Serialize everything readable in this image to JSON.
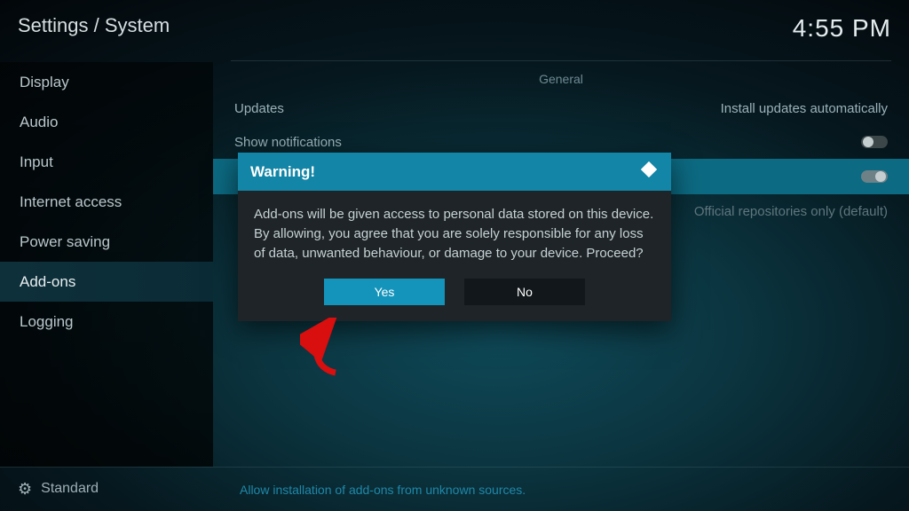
{
  "header": {
    "breadcrumb": "Settings / System",
    "clock": "4:55 PM"
  },
  "sidebar": {
    "items": [
      {
        "label": "Display"
      },
      {
        "label": "Audio"
      },
      {
        "label": "Input"
      },
      {
        "label": "Internet access"
      },
      {
        "label": "Power saving"
      },
      {
        "label": "Add-ons"
      },
      {
        "label": "Logging"
      }
    ],
    "selectedIndex": 5,
    "level_label": "Standard"
  },
  "main": {
    "section_title": "General",
    "rows": {
      "updates": {
        "label": "Updates",
        "value": "Install updates automatically"
      },
      "show_notifications": {
        "label": "Show notifications",
        "toggle": "off"
      },
      "unknown_sources": {
        "label": "",
        "toggle": "on"
      },
      "update_repos": {
        "label": "",
        "value": "Official repositories only (default)"
      }
    },
    "hint": "Allow installation of add-ons from unknown sources."
  },
  "dialog": {
    "title": "Warning!",
    "body": "Add-ons will be given access to personal data stored on this device. By allowing, you agree that you are solely responsible for any loss of data, unwanted behaviour, or damage to your device. Proceed?",
    "yes_label": "Yes",
    "no_label": "No"
  }
}
